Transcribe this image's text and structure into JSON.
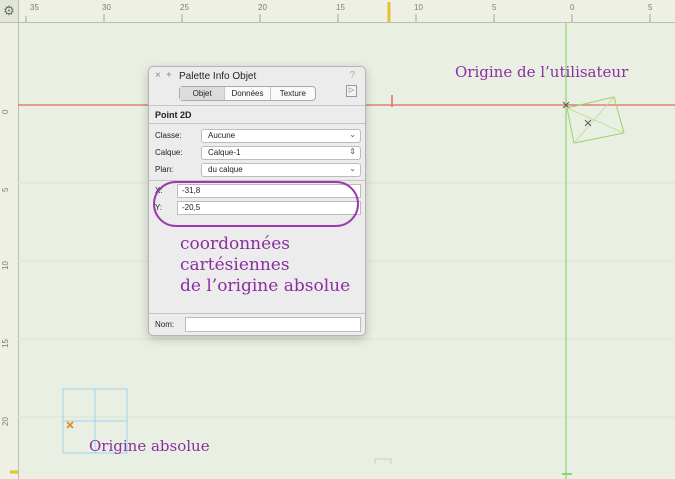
{
  "ruler": {
    "top_labels": [
      "35",
      "30",
      "25",
      "20",
      "15",
      "10",
      "5",
      "0",
      "5"
    ],
    "left_labels": [
      "0",
      "5",
      "10",
      "15",
      "20"
    ],
    "gear_icon": "gear-icon"
  },
  "palette": {
    "title": "Palette Info Objet",
    "close_glyph": "×",
    "pin_glyph": "+",
    "help_glyph": "?",
    "expand_glyph": "▷",
    "tabs": [
      "Objet",
      "Données",
      "Texture"
    ],
    "active_tab": "Objet",
    "heading": "Point 2D",
    "classe_label": "Classe:",
    "classe_value": "Aucune",
    "calque_label": "Calque:",
    "calque_value": "Calque-1",
    "plan_label": "Plan:",
    "plan_value": "du calque",
    "x_label": "X:",
    "x_value": "-31,8",
    "y_label": "Y:",
    "y_value": "-20,5",
    "nom_label": "Nom:",
    "nom_value": ""
  },
  "annotations": {
    "user_origin": "Origine de l’utilisateur",
    "coords_line1": "coordonnées",
    "coords_line2": "cartésiennes",
    "coords_line3": "de l’origine absolue",
    "absolute_origin": "Origine absolue"
  },
  "colors": {
    "annotation": "#8a2fa0",
    "axis_red": "#e26a5a",
    "axis_green": "#8ed46a",
    "grid_blue": "#9fd0ee",
    "origin_orange": "#d98a2a"
  }
}
